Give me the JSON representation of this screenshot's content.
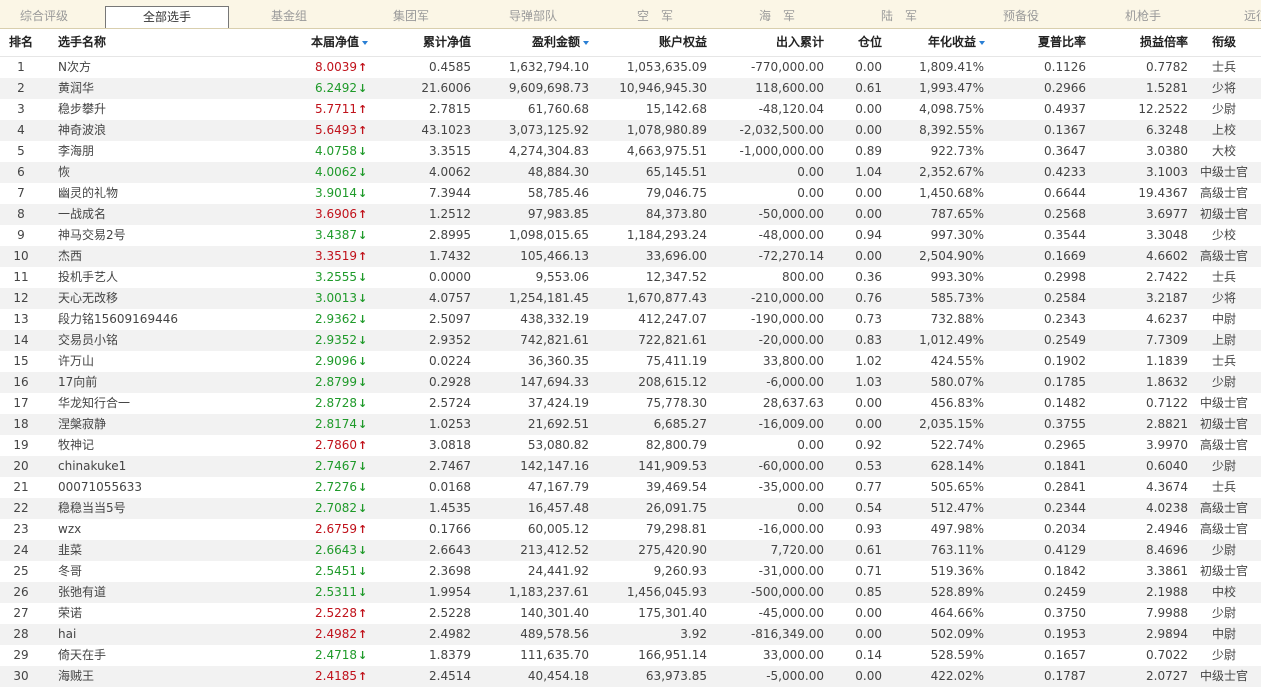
{
  "tabs": [
    {
      "label": "综合评级",
      "active": false
    },
    {
      "label": "全部选手",
      "active": true
    },
    {
      "label": "基金组",
      "active": false
    },
    {
      "label": "集团军",
      "active": false
    },
    {
      "label": "导弹部队",
      "active": false
    },
    {
      "label": "空　军",
      "active": false
    },
    {
      "label": "海　军",
      "active": false
    },
    {
      "label": "陆　军",
      "active": false
    },
    {
      "label": "预备役",
      "active": false
    },
    {
      "label": "机枪手",
      "active": false
    },
    {
      "label": "远征",
      "active": false
    }
  ],
  "columns": [
    {
      "key": "rank",
      "label": "排名",
      "sorted": false
    },
    {
      "key": "name",
      "label": "选手名称",
      "sorted": false
    },
    {
      "key": "nav",
      "label": "本届净值",
      "sorted": true
    },
    {
      "key": "cum_nav",
      "label": "累计净值",
      "sorted": false
    },
    {
      "key": "profit",
      "label": "盈利金额",
      "sorted": true
    },
    {
      "key": "equity",
      "label": "账户权益",
      "sorted": false
    },
    {
      "key": "inout",
      "label": "出入累计",
      "sorted": false
    },
    {
      "key": "position",
      "label": "仓位",
      "sorted": false
    },
    {
      "key": "annual",
      "label": "年化收益",
      "sorted": true
    },
    {
      "key": "sharpe",
      "label": "夏普比率",
      "sorted": false
    },
    {
      "key": "pl_ratio",
      "label": "损益倍率",
      "sorted": false
    },
    {
      "key": "rank_title",
      "label": "衔级",
      "sorted": false
    }
  ],
  "trend_colors": {
    "up": "#c0111a",
    "down": "#1f9a2a"
  },
  "rows": [
    {
      "rank": "1",
      "name": "N次方",
      "nav": "8.0039",
      "trend": "up",
      "cum_nav": "0.4585",
      "profit": "1,632,794.10",
      "equity": "1,053,635.09",
      "inout": "-770,000.00",
      "position": "0.00",
      "annual": "1,809.41%",
      "sharpe": "0.1126",
      "pl_ratio": "0.7782",
      "rank_title": "士兵"
    },
    {
      "rank": "2",
      "name": "黄润华",
      "nav": "6.2492",
      "trend": "down",
      "cum_nav": "21.6006",
      "profit": "9,609,698.73",
      "equity": "10,946,945.30",
      "inout": "118,600.00",
      "position": "0.61",
      "annual": "1,993.47%",
      "sharpe": "0.2966",
      "pl_ratio": "1.5281",
      "rank_title": "少将"
    },
    {
      "rank": "3",
      "name": "稳步攀升",
      "nav": "5.7711",
      "trend": "up",
      "cum_nav": "2.7815",
      "profit": "61,760.68",
      "equity": "15,142.68",
      "inout": "-48,120.04",
      "position": "0.00",
      "annual": "4,098.75%",
      "sharpe": "0.4937",
      "pl_ratio": "12.2522",
      "rank_title": "少尉"
    },
    {
      "rank": "4",
      "name": "神奇波浪",
      "nav": "5.6493",
      "trend": "up",
      "cum_nav": "43.1023",
      "profit": "3,073,125.92",
      "equity": "1,078,980.89",
      "inout": "-2,032,500.00",
      "position": "0.00",
      "annual": "8,392.55%",
      "sharpe": "0.1367",
      "pl_ratio": "6.3248",
      "rank_title": "上校"
    },
    {
      "rank": "5",
      "name": "李海朋",
      "nav": "4.0758",
      "trend": "down",
      "cum_nav": "3.3515",
      "profit": "4,274,304.83",
      "equity": "4,663,975.51",
      "inout": "-1,000,000.00",
      "position": "0.89",
      "annual": "922.73%",
      "sharpe": "0.3647",
      "pl_ratio": "3.0380",
      "rank_title": "大校"
    },
    {
      "rank": "6",
      "name": "恢",
      "nav": "4.0062",
      "trend": "down",
      "cum_nav": "4.0062",
      "profit": "48,884.30",
      "equity": "65,145.51",
      "inout": "0.00",
      "position": "1.04",
      "annual": "2,352.67%",
      "sharpe": "0.4233",
      "pl_ratio": "3.1003",
      "rank_title": "中级士官"
    },
    {
      "rank": "7",
      "name": "幽灵的礼物",
      "nav": "3.9014",
      "trend": "down",
      "cum_nav": "7.3944",
      "profit": "58,785.46",
      "equity": "79,046.75",
      "inout": "0.00",
      "position": "0.00",
      "annual": "1,450.68%",
      "sharpe": "0.6644",
      "pl_ratio": "19.4367",
      "rank_title": "高级士官"
    },
    {
      "rank": "8",
      "name": "一战成名",
      "nav": "3.6906",
      "trend": "up",
      "cum_nav": "1.2512",
      "profit": "97,983.85",
      "equity": "84,373.80",
      "inout": "-50,000.00",
      "position": "0.00",
      "annual": "787.65%",
      "sharpe": "0.2568",
      "pl_ratio": "3.6977",
      "rank_title": "初级士官"
    },
    {
      "rank": "9",
      "name": "神马交易2号",
      "nav": "3.4387",
      "trend": "down",
      "cum_nav": "2.8995",
      "profit": "1,098,015.65",
      "equity": "1,184,293.24",
      "inout": "-48,000.00",
      "position": "0.94",
      "annual": "997.30%",
      "sharpe": "0.3544",
      "pl_ratio": "3.3048",
      "rank_title": "少校"
    },
    {
      "rank": "10",
      "name": "杰西",
      "nav": "3.3519",
      "trend": "up",
      "cum_nav": "1.7432",
      "profit": "105,466.13",
      "equity": "33,696.00",
      "inout": "-72,270.14",
      "position": "0.00",
      "annual": "2,504.90%",
      "sharpe": "0.1669",
      "pl_ratio": "4.6602",
      "rank_title": "高级士官"
    },
    {
      "rank": "11",
      "name": "投机手艺人",
      "nav": "3.2555",
      "trend": "down",
      "cum_nav": "0.0000",
      "profit": "9,553.06",
      "equity": "12,347.52",
      "inout": "800.00",
      "position": "0.36",
      "annual": "993.30%",
      "sharpe": "0.2998",
      "pl_ratio": "2.7422",
      "rank_title": "士兵"
    },
    {
      "rank": "12",
      "name": "天心无改移",
      "nav": "3.0013",
      "trend": "down",
      "cum_nav": "4.0757",
      "profit": "1,254,181.45",
      "equity": "1,670,877.43",
      "inout": "-210,000.00",
      "position": "0.76",
      "annual": "585.73%",
      "sharpe": "0.2584",
      "pl_ratio": "3.2187",
      "rank_title": "少将"
    },
    {
      "rank": "13",
      "name": "段力铭15609169446",
      "nav": "2.9362",
      "trend": "down",
      "cum_nav": "2.5097",
      "profit": "438,332.19",
      "equity": "412,247.07",
      "inout": "-190,000.00",
      "position": "0.73",
      "annual": "732.88%",
      "sharpe": "0.2343",
      "pl_ratio": "4.6237",
      "rank_title": "中尉"
    },
    {
      "rank": "14",
      "name": "交易员小铭",
      "nav": "2.9352",
      "trend": "down",
      "cum_nav": "2.9352",
      "profit": "742,821.61",
      "equity": "722,821.61",
      "inout": "-20,000.00",
      "position": "0.83",
      "annual": "1,012.49%",
      "sharpe": "0.2549",
      "pl_ratio": "7.7309",
      "rank_title": "上尉"
    },
    {
      "rank": "15",
      "name": "许万山",
      "nav": "2.9096",
      "trend": "down",
      "cum_nav": "0.0224",
      "profit": "36,360.35",
      "equity": "75,411.19",
      "inout": "33,800.00",
      "position": "1.02",
      "annual": "424.55%",
      "sharpe": "0.1902",
      "pl_ratio": "1.1839",
      "rank_title": "士兵"
    },
    {
      "rank": "16",
      "name": "17向前",
      "nav": "2.8799",
      "trend": "down",
      "cum_nav": "0.2928",
      "profit": "147,694.33",
      "equity": "208,615.12",
      "inout": "-6,000.00",
      "position": "1.03",
      "annual": "580.07%",
      "sharpe": "0.1785",
      "pl_ratio": "1.8632",
      "rank_title": "少尉"
    },
    {
      "rank": "17",
      "name": "华龙知行合一",
      "nav": "2.8728",
      "trend": "down",
      "cum_nav": "2.5724",
      "profit": "37,424.19",
      "equity": "75,778.30",
      "inout": "28,637.63",
      "position": "0.00",
      "annual": "456.83%",
      "sharpe": "0.1482",
      "pl_ratio": "0.7122",
      "rank_title": "中级士官"
    },
    {
      "rank": "18",
      "name": "涅槃寂静",
      "nav": "2.8174",
      "trend": "down",
      "cum_nav": "1.0253",
      "profit": "21,692.51",
      "equity": "6,685.27",
      "inout": "-16,009.00",
      "position": "0.00",
      "annual": "2,035.15%",
      "sharpe": "0.3755",
      "pl_ratio": "2.8821",
      "rank_title": "初级士官"
    },
    {
      "rank": "19",
      "name": "牧神记",
      "nav": "2.7860",
      "trend": "up",
      "cum_nav": "3.0818",
      "profit": "53,080.82",
      "equity": "82,800.79",
      "inout": "0.00",
      "position": "0.92",
      "annual": "522.74%",
      "sharpe": "0.2965",
      "pl_ratio": "3.9970",
      "rank_title": "高级士官"
    },
    {
      "rank": "20",
      "name": "chinakuke1",
      "nav": "2.7467",
      "trend": "down",
      "cum_nav": "2.7467",
      "profit": "142,147.16",
      "equity": "141,909.53",
      "inout": "-60,000.00",
      "position": "0.53",
      "annual": "628.14%",
      "sharpe": "0.1841",
      "pl_ratio": "0.6040",
      "rank_title": "少尉"
    },
    {
      "rank": "21",
      "name": "00071055633",
      "nav": "2.7276",
      "trend": "down",
      "cum_nav": "0.0168",
      "profit": "47,167.79",
      "equity": "39,469.54",
      "inout": "-35,000.00",
      "position": "0.77",
      "annual": "505.65%",
      "sharpe": "0.2841",
      "pl_ratio": "4.3674",
      "rank_title": "士兵"
    },
    {
      "rank": "22",
      "name": "稳稳当当5号",
      "nav": "2.7082",
      "trend": "down",
      "cum_nav": "1.4535",
      "profit": "16,457.48",
      "equity": "26,091.75",
      "inout": "0.00",
      "position": "0.54",
      "annual": "512.47%",
      "sharpe": "0.2344",
      "pl_ratio": "4.0238",
      "rank_title": "高级士官"
    },
    {
      "rank": "23",
      "name": "wzx",
      "nav": "2.6759",
      "trend": "up",
      "cum_nav": "0.1766",
      "profit": "60,005.12",
      "equity": "79,298.81",
      "inout": "-16,000.00",
      "position": "0.93",
      "annual": "497.98%",
      "sharpe": "0.2034",
      "pl_ratio": "2.4946",
      "rank_title": "高级士官"
    },
    {
      "rank": "24",
      "name": "韭菜",
      "nav": "2.6643",
      "trend": "down",
      "cum_nav": "2.6643",
      "profit": "213,412.52",
      "equity": "275,420.90",
      "inout": "7,720.00",
      "position": "0.61",
      "annual": "763.11%",
      "sharpe": "0.4129",
      "pl_ratio": "8.4696",
      "rank_title": "少尉"
    },
    {
      "rank": "25",
      "name": "冬哥",
      "nav": "2.5451",
      "trend": "down",
      "cum_nav": "2.3698",
      "profit": "24,441.92",
      "equity": "9,260.93",
      "inout": "-31,000.00",
      "position": "0.71",
      "annual": "519.36%",
      "sharpe": "0.1842",
      "pl_ratio": "3.3861",
      "rank_title": "初级士官"
    },
    {
      "rank": "26",
      "name": "张弛有道",
      "nav": "2.5311",
      "trend": "down",
      "cum_nav": "1.9954",
      "profit": "1,183,237.61",
      "equity": "1,456,045.93",
      "inout": "-500,000.00",
      "position": "0.85",
      "annual": "528.89%",
      "sharpe": "0.2459",
      "pl_ratio": "2.1988",
      "rank_title": "中校"
    },
    {
      "rank": "27",
      "name": "荣诺",
      "nav": "2.5228",
      "trend": "up",
      "cum_nav": "2.5228",
      "profit": "140,301.40",
      "equity": "175,301.40",
      "inout": "-45,000.00",
      "position": "0.00",
      "annual": "464.66%",
      "sharpe": "0.3750",
      "pl_ratio": "7.9988",
      "rank_title": "少尉"
    },
    {
      "rank": "28",
      "name": "hai",
      "nav": "2.4982",
      "trend": "up",
      "cum_nav": "2.4982",
      "profit": "489,578.56",
      "equity": "3.92",
      "inout": "-816,349.00",
      "position": "0.00",
      "annual": "502.09%",
      "sharpe": "0.1953",
      "pl_ratio": "2.9894",
      "rank_title": "中尉"
    },
    {
      "rank": "29",
      "name": "倚天在手",
      "nav": "2.4718",
      "trend": "down",
      "cum_nav": "1.8379",
      "profit": "111,635.70",
      "equity": "166,951.14",
      "inout": "33,000.00",
      "position": "0.14",
      "annual": "528.59%",
      "sharpe": "0.1657",
      "pl_ratio": "0.7022",
      "rank_title": "少尉"
    },
    {
      "rank": "30",
      "name": "海贼王",
      "nav": "2.4185",
      "trend": "up",
      "cum_nav": "2.4514",
      "profit": "40,454.18",
      "equity": "63,973.85",
      "inout": "-5,000.00",
      "position": "0.00",
      "annual": "422.02%",
      "sharpe": "0.1787",
      "pl_ratio": "2.0727",
      "rank_title": "中级士官"
    }
  ]
}
